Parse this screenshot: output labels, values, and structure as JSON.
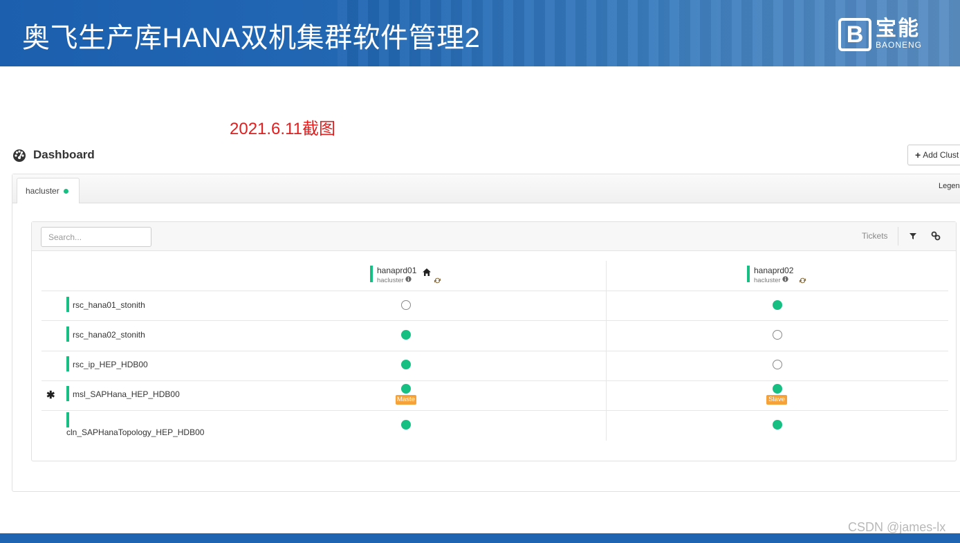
{
  "slide": {
    "title": "奥飞生产库HANA双机集群软件管理2",
    "logo_mark": "B",
    "logo_cn": "宝能",
    "logo_en": "BAONENG",
    "caption": "2021.6.11截图",
    "watermark": "CSDN @james-lx"
  },
  "dashboard": {
    "title": "Dashboard",
    "add_button": "Add Clust",
    "tab_label": "hacluster",
    "legend_label": "Legend",
    "search_placeholder": "Search...",
    "tickets_label": "Tickets",
    "filter_icon": "filter-icon",
    "link_icon": "link-icon"
  },
  "nodes": [
    {
      "name": "hanaprd01",
      "cluster": "hacluster",
      "is_home": true,
      "icons": [
        "info-icon",
        "home-icon",
        "refresh-icon"
      ]
    },
    {
      "name": "hanaprd02",
      "cluster": "hacluster",
      "is_home": false,
      "icons": [
        "info-icon",
        "refresh-icon"
      ]
    }
  ],
  "resources": [
    {
      "name": "rsc_hana01_stonith",
      "states": [
        "stopped",
        "running"
      ],
      "roles": [
        "",
        ""
      ],
      "multistate": false
    },
    {
      "name": "rsc_hana02_stonith",
      "states": [
        "running",
        "stopped"
      ],
      "roles": [
        "",
        ""
      ],
      "multistate": false
    },
    {
      "name": "rsc_ip_HEP_HDB00",
      "states": [
        "running",
        "stopped"
      ],
      "roles": [
        "",
        ""
      ],
      "multistate": false
    },
    {
      "name": "msl_SAPHana_HEP_HDB00",
      "states": [
        "running",
        "running"
      ],
      "roles": [
        "Maste",
        "Slave"
      ],
      "multistate": true
    },
    {
      "name": "cln_SAPHanaTopology_HEP_HDB00",
      "states": [
        "running",
        "running"
      ],
      "roles": [
        "",
        ""
      ],
      "multistate": false
    }
  ],
  "colors": {
    "running": "#17bf83",
    "role_badge": "#f5a23a",
    "banner": "#1f64b0",
    "caption": "#e02020"
  }
}
